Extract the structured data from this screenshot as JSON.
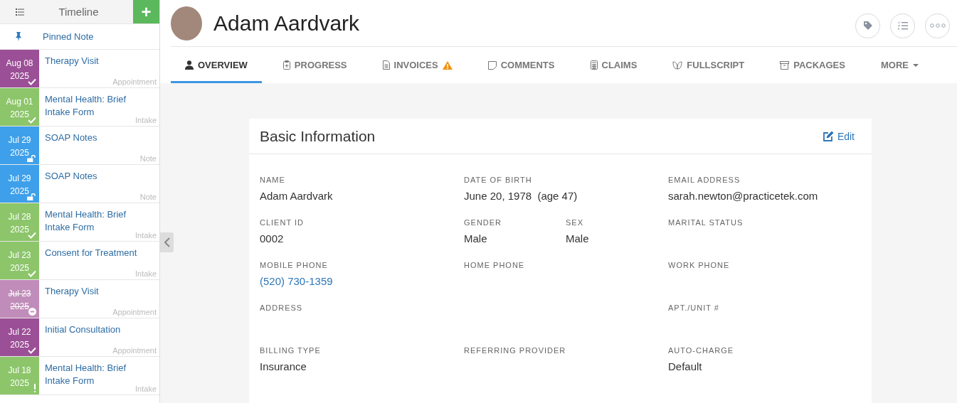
{
  "sidebar": {
    "title": "Timeline",
    "add_button": "+",
    "pinned": "Pinned Note",
    "items": [
      {
        "date": "Aug 08",
        "year": "2025",
        "title": "Therapy Visit",
        "type": "Appointment",
        "color": "#9b4f96",
        "kind": "done",
        "cancelled": false
      },
      {
        "date": "Aug 01",
        "year": "2025",
        "title": "Mental Health: Brief Intake Form",
        "type": "Intake",
        "color": "#8cc56a",
        "kind": "done",
        "cancelled": false
      },
      {
        "date": "Jul 29",
        "year": "2025",
        "title": "SOAP Notes",
        "type": "Note",
        "color": "#3ea0ea",
        "kind": "unlocked",
        "cancelled": false
      },
      {
        "date": "Jul 29",
        "year": "2025",
        "title": "SOAP Notes",
        "type": "Note",
        "color": "#3ea0ea",
        "kind": "unlocked",
        "cancelled": false
      },
      {
        "date": "Jul 28",
        "year": "2025",
        "title": "Mental Health: Brief Intake Form",
        "type": "Intake",
        "color": "#8cc56a",
        "kind": "done",
        "cancelled": false
      },
      {
        "date": "Jul 23",
        "year": "2025",
        "title": "Consent for Treatment",
        "type": "Intake",
        "color": "#8cc56a",
        "kind": "done",
        "cancelled": false
      },
      {
        "date": "Jul 23",
        "year": "2025",
        "title": "Therapy Visit",
        "type": "Appointment",
        "color": "#c08cba",
        "kind": "cancelled",
        "cancelled": true
      },
      {
        "date": "Jul 22",
        "year": "2025",
        "title": "Initial Consultation",
        "type": "Appointment",
        "color": "#9b4f96",
        "kind": "done",
        "cancelled": false
      },
      {
        "date": "Jul 18",
        "year": "2025",
        "title": "Mental Health: Brief Intake Form",
        "type": "Intake",
        "color": "#8cc56a",
        "kind": "alert",
        "cancelled": false
      }
    ]
  },
  "client": {
    "name": "Adam Aardvark"
  },
  "tabs": [
    {
      "label": "OVERVIEW",
      "selected": true,
      "warning": false,
      "dropdown": false
    },
    {
      "label": "PROGRESS",
      "selected": false,
      "warning": false,
      "dropdown": false
    },
    {
      "label": "INVOICES",
      "selected": false,
      "warning": true,
      "dropdown": false
    },
    {
      "label": "COMMENTS",
      "selected": false,
      "warning": false,
      "dropdown": false
    },
    {
      "label": "CLAIMS",
      "selected": false,
      "warning": false,
      "dropdown": false
    },
    {
      "label": "FULLSCRIPT",
      "selected": false,
      "warning": false,
      "dropdown": false
    },
    {
      "label": "PACKAGES",
      "selected": false,
      "warning": false,
      "dropdown": false
    },
    {
      "label": "MORE",
      "selected": false,
      "warning": false,
      "dropdown": true
    }
  ],
  "card": {
    "title": "Basic Information",
    "edit": "Edit",
    "rows": [
      [
        {
          "label": "NAME",
          "value": "Adam Aardvark"
        },
        {
          "label": "DATE OF BIRTH",
          "value": "June 20, 1978  (age 47)"
        },
        {
          "label": "EMAIL ADDRESS",
          "value": "sarah.newton@practicetek.com"
        }
      ],
      [
        {
          "label": "CLIENT ID",
          "value": "0002"
        },
        {
          "parts": [
            {
              "label": "GENDER",
              "value": "Male"
            },
            {
              "label": "SEX",
              "value": "Male"
            }
          ]
        },
        {
          "label": "MARITAL STATUS"
        }
      ],
      [
        {
          "label": "MOBILE PHONE",
          "value": "(520) 730-1359",
          "link": true
        },
        {
          "label": "HOME PHONE"
        },
        {
          "label": "WORK PHONE"
        }
      ],
      [
        {
          "label": "ADDRESS"
        },
        {},
        {
          "label": "APT./UNIT #"
        }
      ],
      [
        {
          "label": "BILLING TYPE",
          "value": "Insurance"
        },
        {
          "label": "REFERRING PROVIDER"
        },
        {
          "label": "AUTO-CHARGE",
          "value": "Default"
        }
      ]
    ]
  }
}
